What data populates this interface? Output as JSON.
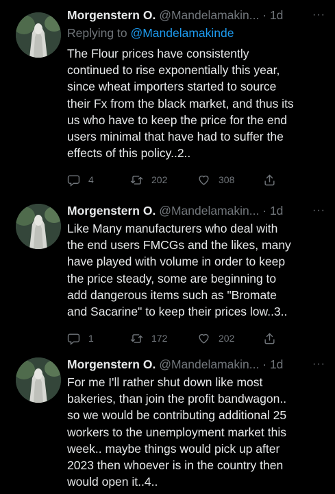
{
  "tweets": [
    {
      "author": "Morgenstern O.",
      "handle": "@Mandelamakin...",
      "separator": "·",
      "time": "1d",
      "more": "···",
      "reply_prefix": "Replying to",
      "reply_to": "@Mandelamakinde",
      "lines": [
        "The Flour prices have consistently",
        "continued to rise exponentially this year,",
        "since wheat importers started to source",
        "their Fx from the black market, and thus its",
        "us who have to keep the price for the end",
        "users minimal that have had to suffer the",
        "effects of this policy..2.."
      ],
      "replies": "4",
      "retweets": "202",
      "likes": "308"
    },
    {
      "author": "Morgenstern O.",
      "handle": "@Mandelamakin...",
      "separator": "·",
      "time": "1d",
      "more": "···",
      "lines": [
        "Like Many manufacturers who deal with",
        "the end users FMCGs and the likes, many",
        "have played with volume in order to keep",
        "the price steady, some are beginning to",
        "add dangerous items such as \"Bromate",
        "and Sacarine\" to keep their prices low..3.."
      ],
      "replies": "1",
      "retweets": "172",
      "likes": "202"
    },
    {
      "author": "Morgenstern O.",
      "handle": "@Mandelamakin...",
      "separator": "·",
      "time": "1d",
      "more": "···",
      "lines": [
        "For me I'll rather shut down like most",
        "bakeries, than join the profit bandwagon..",
        "so we would be contributing additional 25",
        "workers to the unemployment market this",
        "week.. maybe things would pick up after",
        "2023 then whoever is in the country then",
        "would open it..4.."
      ]
    }
  ]
}
